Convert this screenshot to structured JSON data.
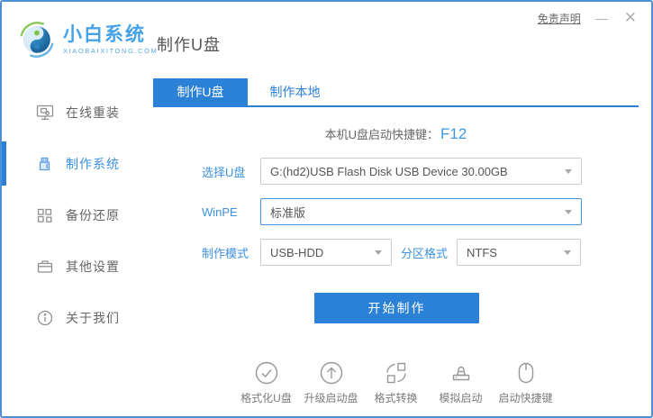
{
  "colors": {
    "accent": "#2b81d6",
    "label_blue": "#3d91e0",
    "hotkey_blue": "#3d9ae1",
    "window_border": "#4c90d8"
  },
  "header": {
    "logo_title": "小白系统",
    "logo_subtitle": "XIAOBAIXITONG.COM",
    "page_title": "制作U盘",
    "disclaimer": "免责声明",
    "minimize": "—",
    "close": "✕"
  },
  "sidebar": {
    "items": [
      {
        "label": "在线重装",
        "icon": "monitor-reinstall-icon"
      },
      {
        "label": "制作系统",
        "icon": "usb-drive-icon"
      },
      {
        "label": "备份还原",
        "icon": "backup-grid-icon"
      },
      {
        "label": "其他设置",
        "icon": "toolbox-icon"
      },
      {
        "label": "关于我们",
        "icon": "info-icon"
      }
    ]
  },
  "main": {
    "tabs": [
      {
        "label": "制作U盘"
      },
      {
        "label": "制作本地"
      }
    ],
    "hotkey": {
      "prefix": "本机U盘启动快捷键：",
      "key": "F12"
    },
    "form": {
      "select_usb_label": "选择U盘",
      "select_usb_value": "G:(hd2)USB Flash Disk USB Device 30.00GB",
      "winpe_label": "WinPE",
      "winpe_value": "标准版",
      "mode_label": "制作模式",
      "mode_value": "USB-HDD",
      "partition_label": "分区格式",
      "partition_value": "NTFS"
    },
    "start_button": "开始制作",
    "tools": [
      {
        "label": "格式化U盘",
        "icon": "format-check-icon"
      },
      {
        "label": "升级启动盘",
        "icon": "upgrade-arrow-icon"
      },
      {
        "label": "格式转换",
        "icon": "convert-icon"
      },
      {
        "label": "模拟启动",
        "icon": "stamp-icon"
      },
      {
        "label": "启动快捷键",
        "icon": "mouse-icon"
      }
    ]
  }
}
